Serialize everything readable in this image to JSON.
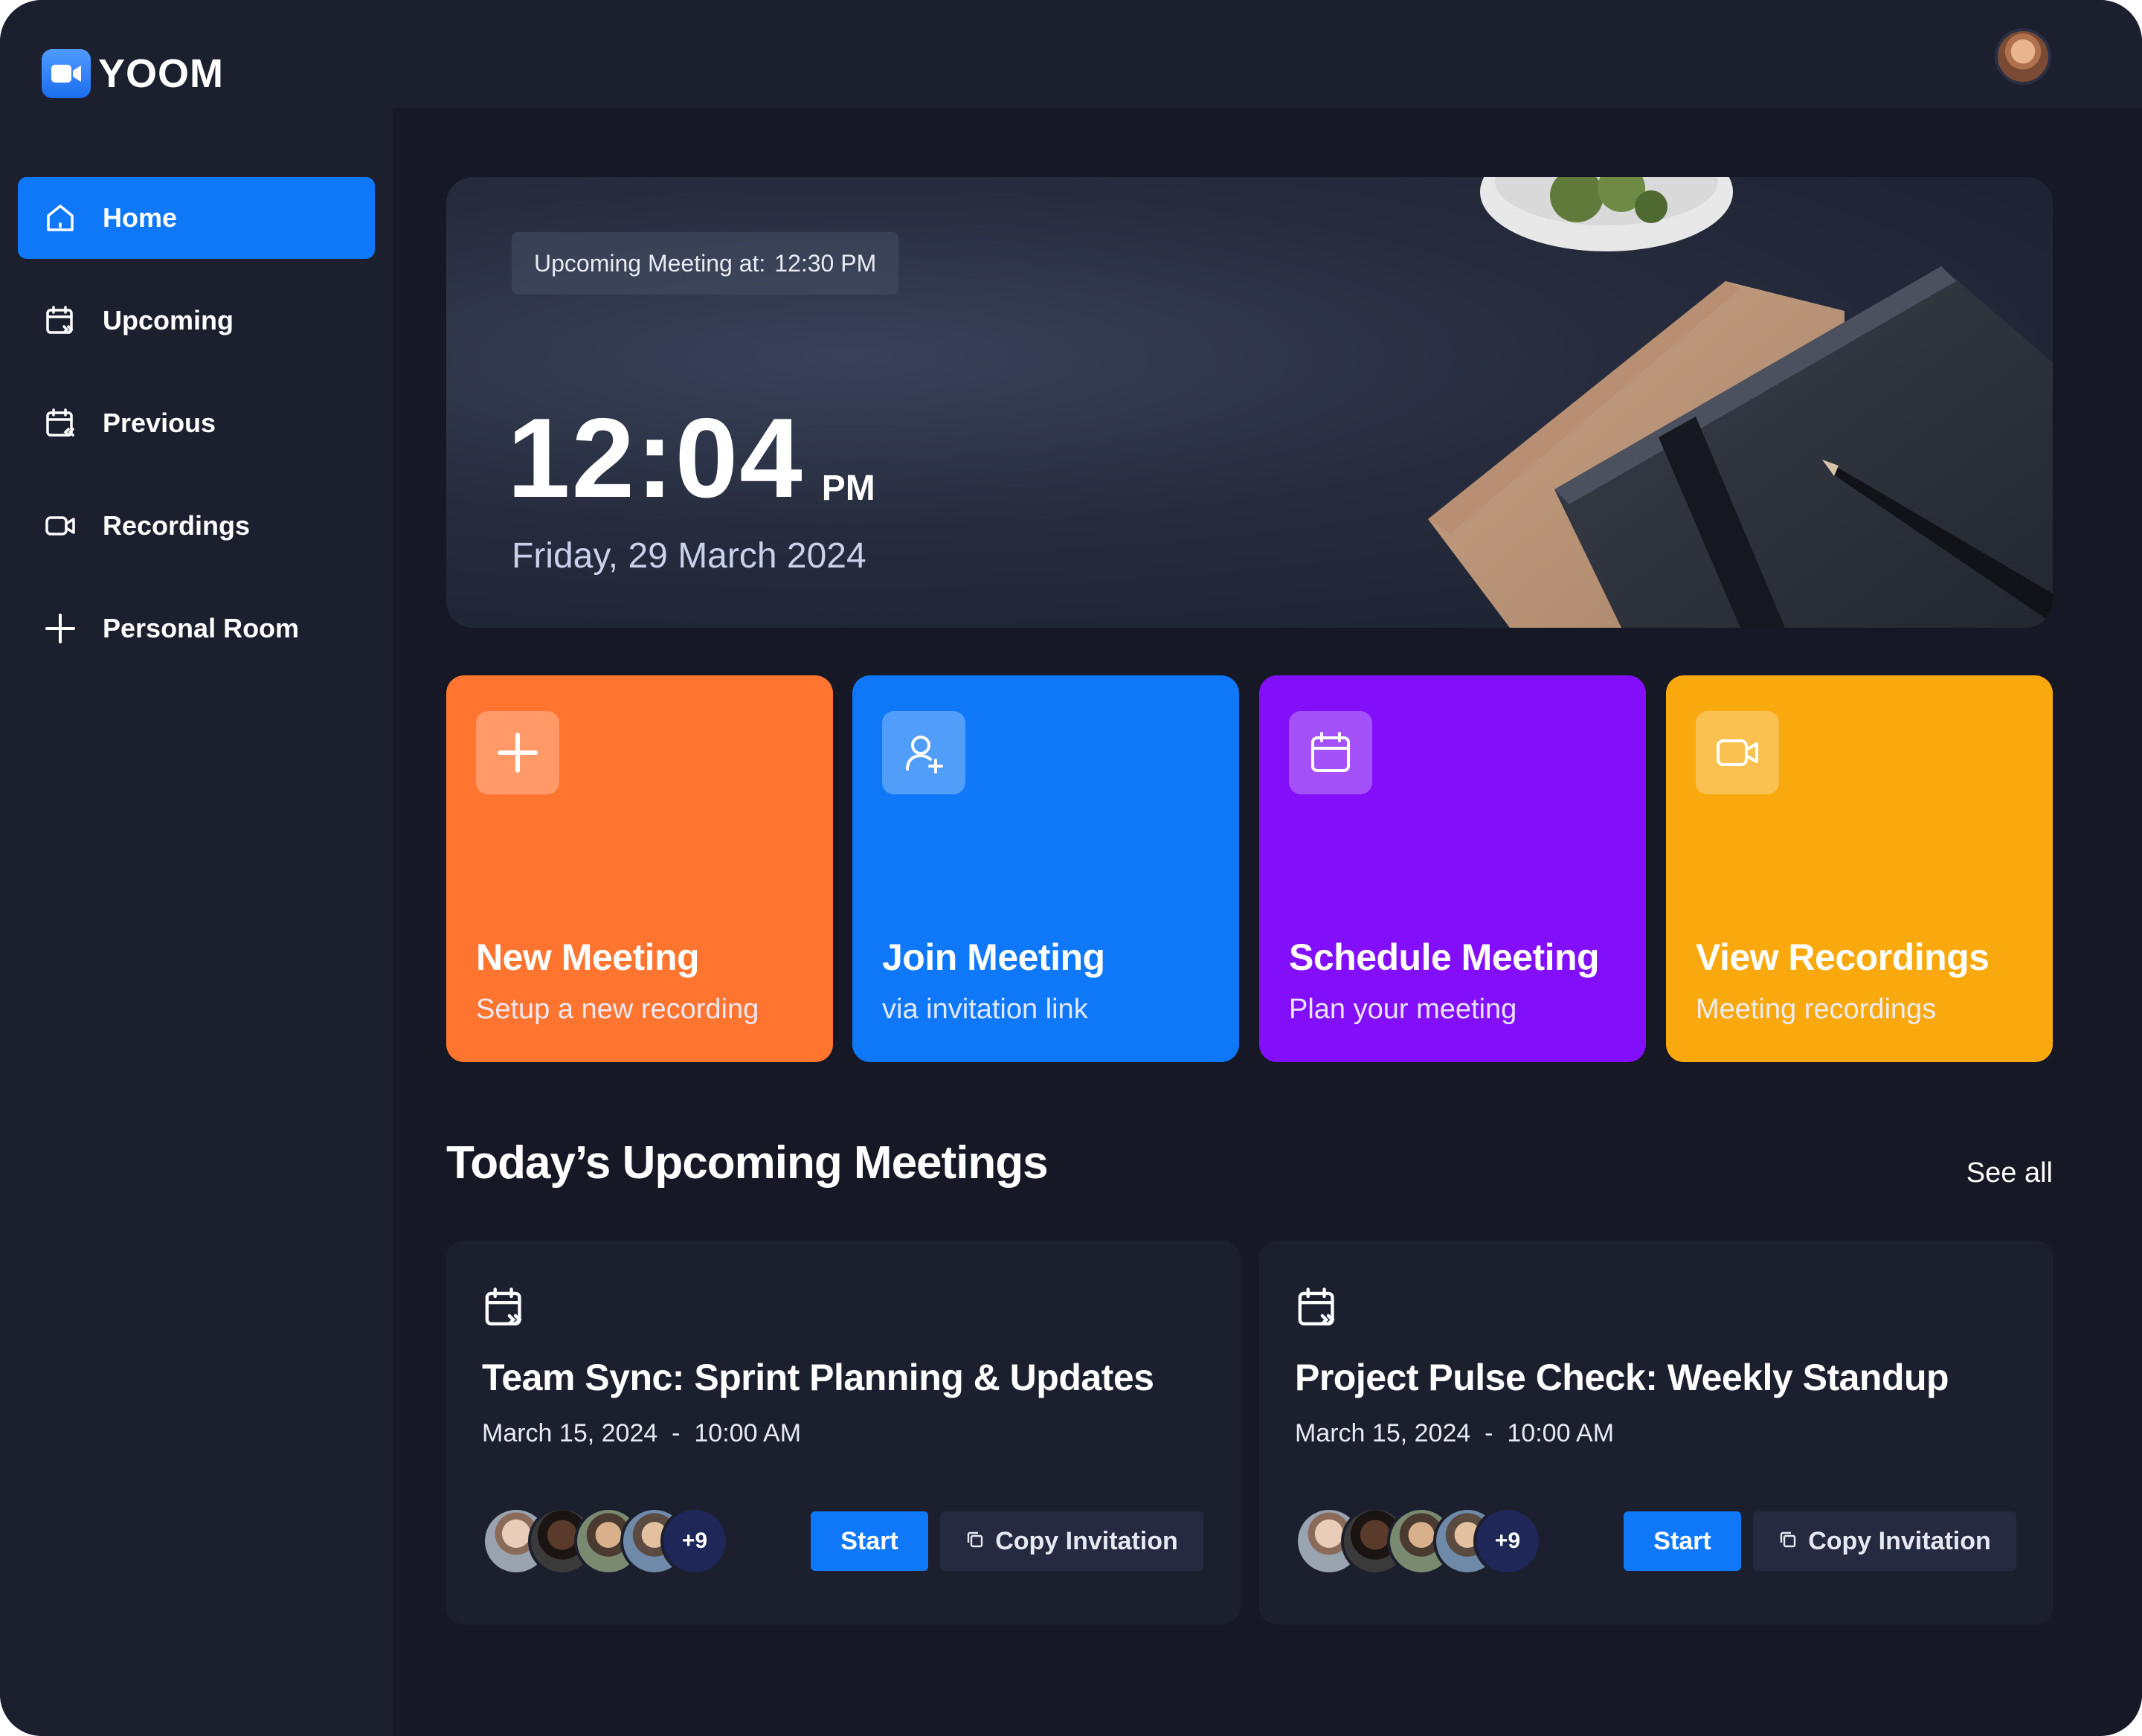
{
  "app": {
    "name": "YOOM"
  },
  "sidebar": {
    "items": [
      {
        "label": "Home",
        "icon": "home-icon",
        "active": true
      },
      {
        "label": "Upcoming",
        "icon": "calendar-upcoming-icon"
      },
      {
        "label": "Previous",
        "icon": "calendar-previous-icon"
      },
      {
        "label": "Recordings",
        "icon": "video-icon"
      },
      {
        "label": "Personal Room",
        "icon": "plus-icon"
      }
    ]
  },
  "hero": {
    "badge_label": "Upcoming Meeting at:",
    "badge_time": "12:30 PM",
    "time": "12:04",
    "ampm": "PM",
    "date": "Friday, 29 March 2024"
  },
  "cards": [
    {
      "title": "New Meeting",
      "subtitle": "Setup a new recording",
      "color": "#ff742e",
      "icon": "plus-icon"
    },
    {
      "title": "Join Meeting",
      "subtitle": "via invitation link",
      "color": "#0e78f9",
      "icon": "add-user-icon"
    },
    {
      "title": "Schedule Meeting",
      "subtitle": "Plan your meeting",
      "color": "#830ef9",
      "icon": "calendar-icon"
    },
    {
      "title": "View Recordings",
      "subtitle": "Meeting recordings",
      "color": "#f9a90e",
      "icon": "video-icon"
    }
  ],
  "upcoming": {
    "title": "Today’s Upcoming Meetings",
    "see_all": "See all",
    "meetings": [
      {
        "title": "Team Sync: Sprint Planning & Updates",
        "date": "March 15, 2024",
        "time": "10:00 AM",
        "more_count": "+9",
        "start_label": "Start",
        "copy_label": "Copy Invitation"
      },
      {
        "title": "Project Pulse Check: Weekly Standup",
        "date": "March 15, 2024",
        "time": "10:00 AM",
        "more_count": "+9",
        "start_label": "Start",
        "copy_label": "Copy Invitation"
      }
    ]
  },
  "colors": {
    "accent": "#0e78f9",
    "background": "#1c1f2e",
    "main_background": "#161925"
  }
}
